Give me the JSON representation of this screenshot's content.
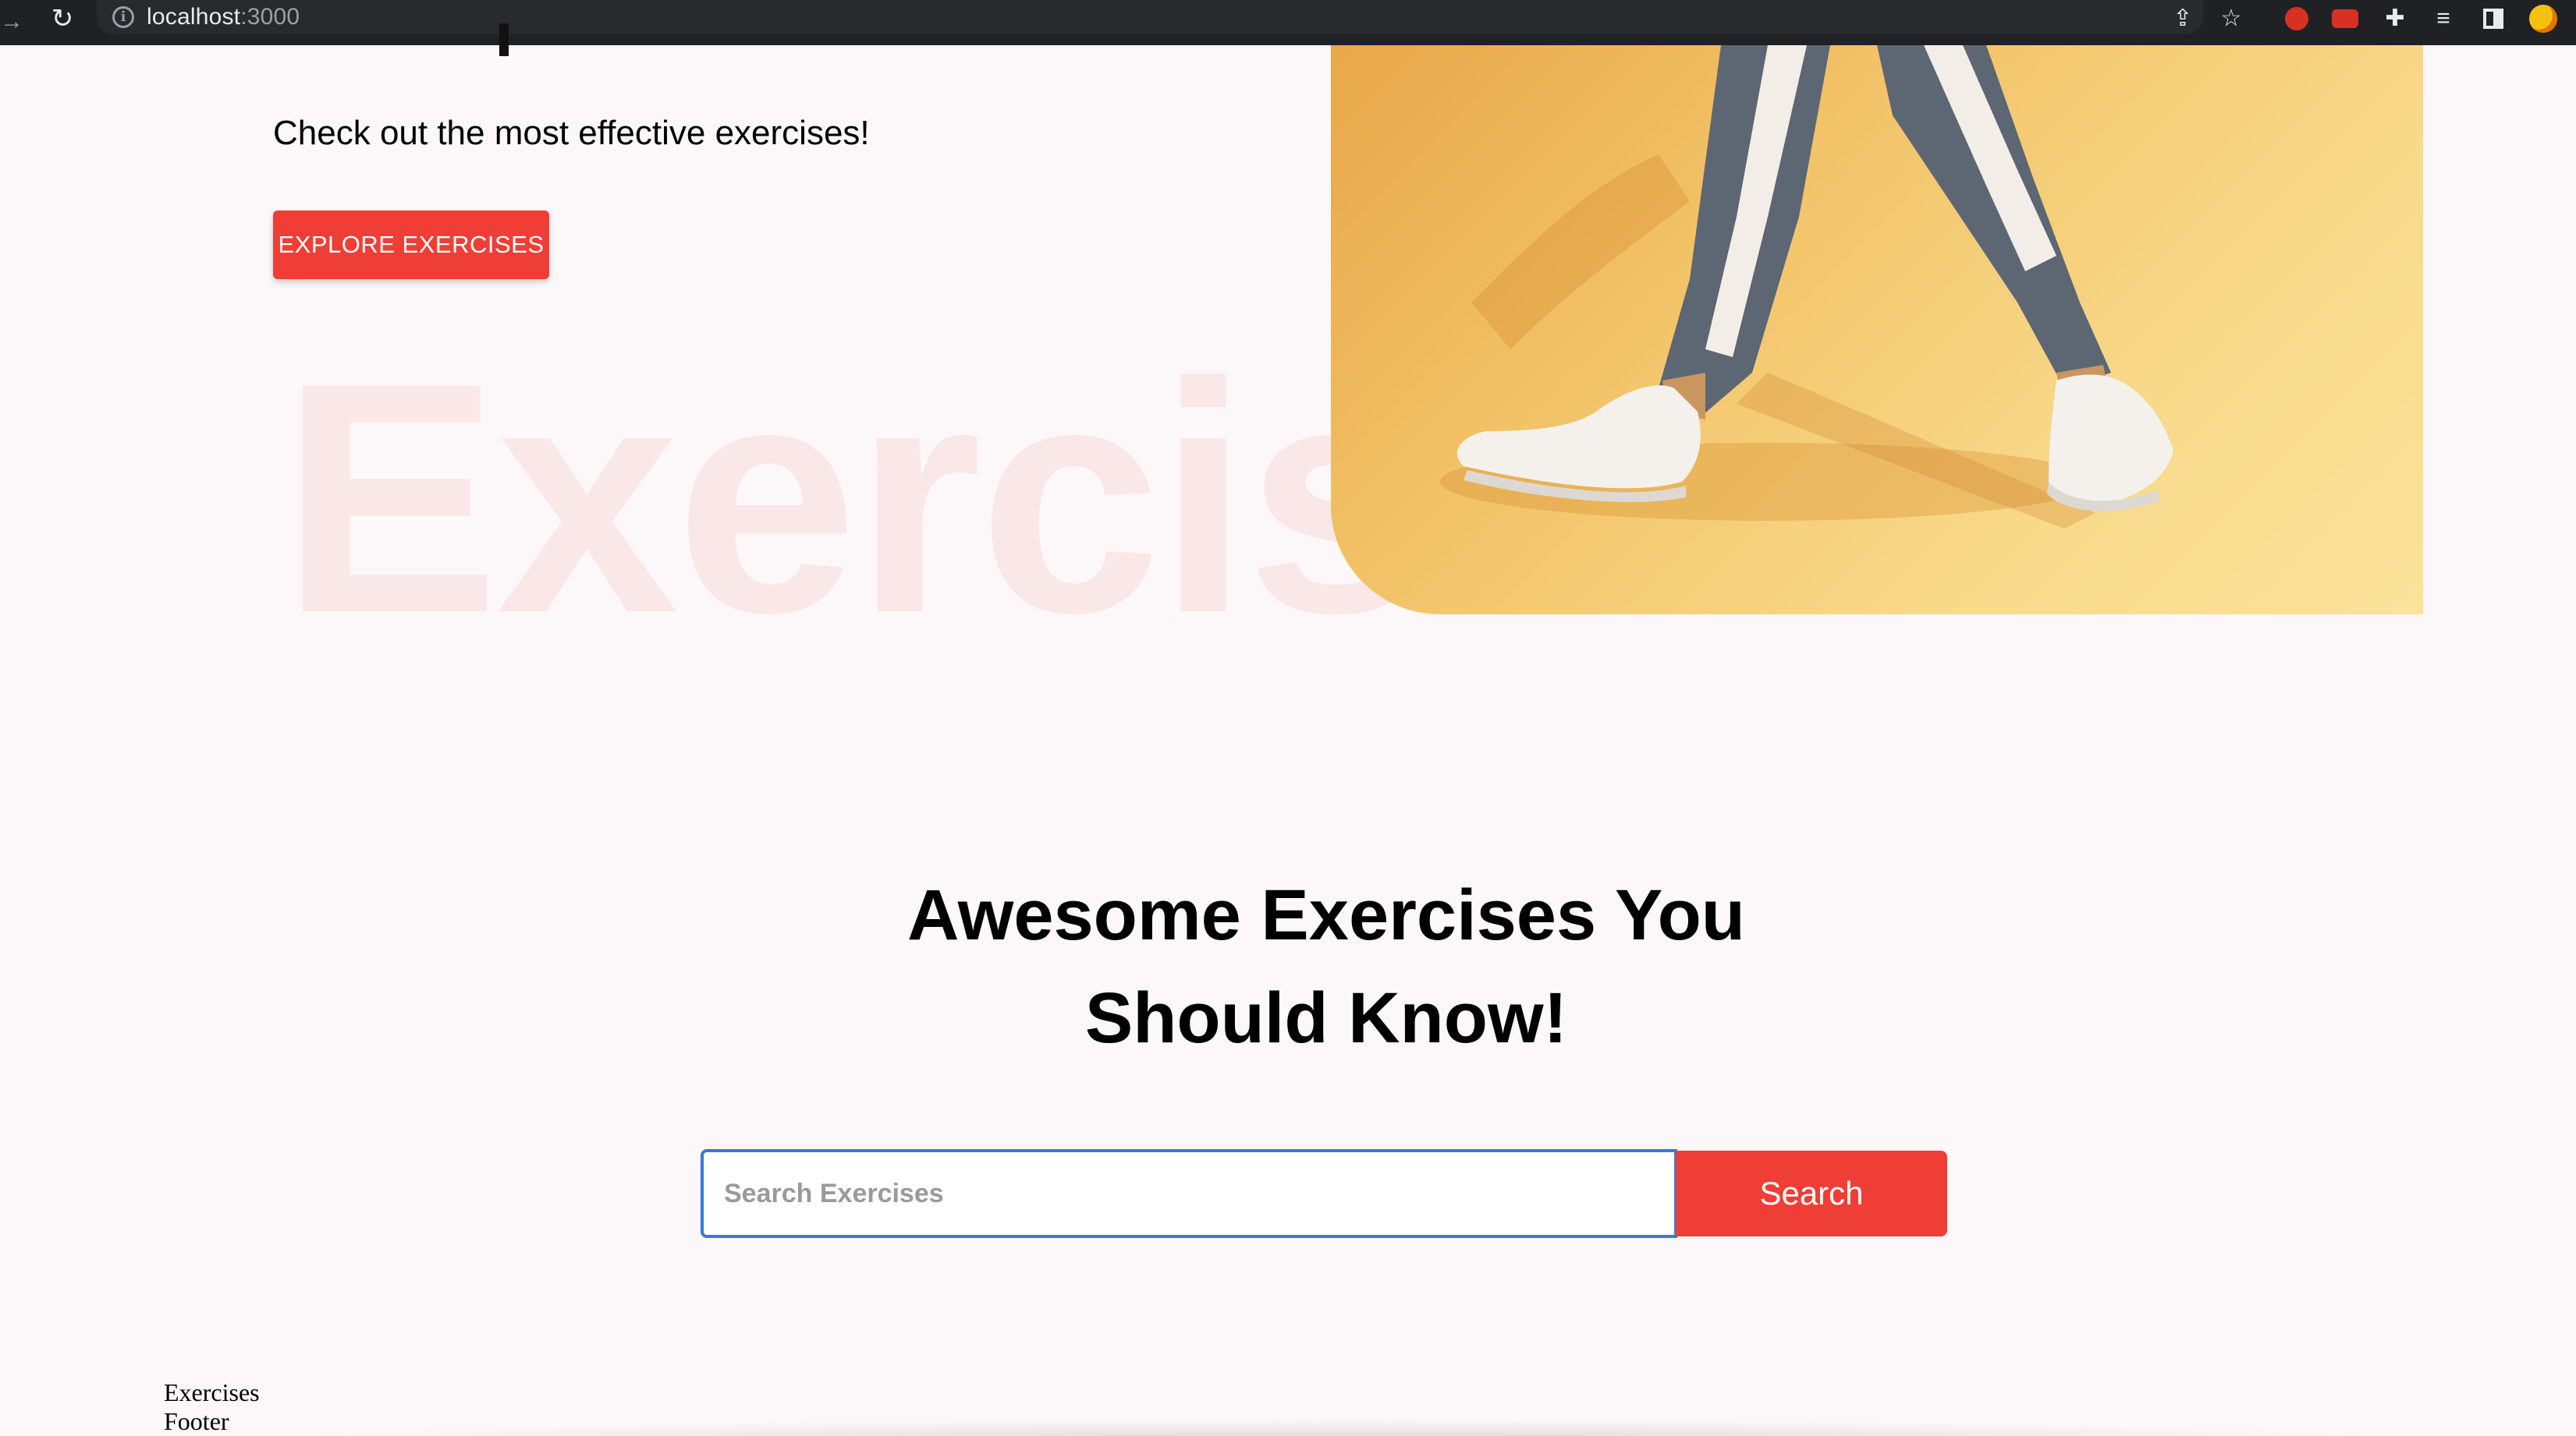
{
  "browser": {
    "url_host": "localhost",
    "url_port": ":3000"
  },
  "hero": {
    "subtitle": "Check out the most effective exercises!",
    "cta_label": "EXPLORE EXERCISES",
    "watermark": "Exercises"
  },
  "search_section": {
    "title_line1": "Awesome Exercises You",
    "title_line2": "Should Know!",
    "placeholder": "Search Exercises",
    "button_label": "Search"
  },
  "footer": {
    "line1": "Exercises",
    "line2": "Footer"
  },
  "colors": {
    "accent": "#ef3e36",
    "page_background": "#fcf7f8",
    "input_border": "#3b78d8",
    "hero_image_background": "#f8d98a"
  },
  "icons": [
    "back-arrow-icon",
    "reload-icon",
    "site-info-icon",
    "share-icon",
    "star-icon",
    "extension-icon",
    "youtube-extension-icon",
    "puzzle-icon",
    "media-icon",
    "side-panel-icon",
    "profile-avatar-icon"
  ]
}
